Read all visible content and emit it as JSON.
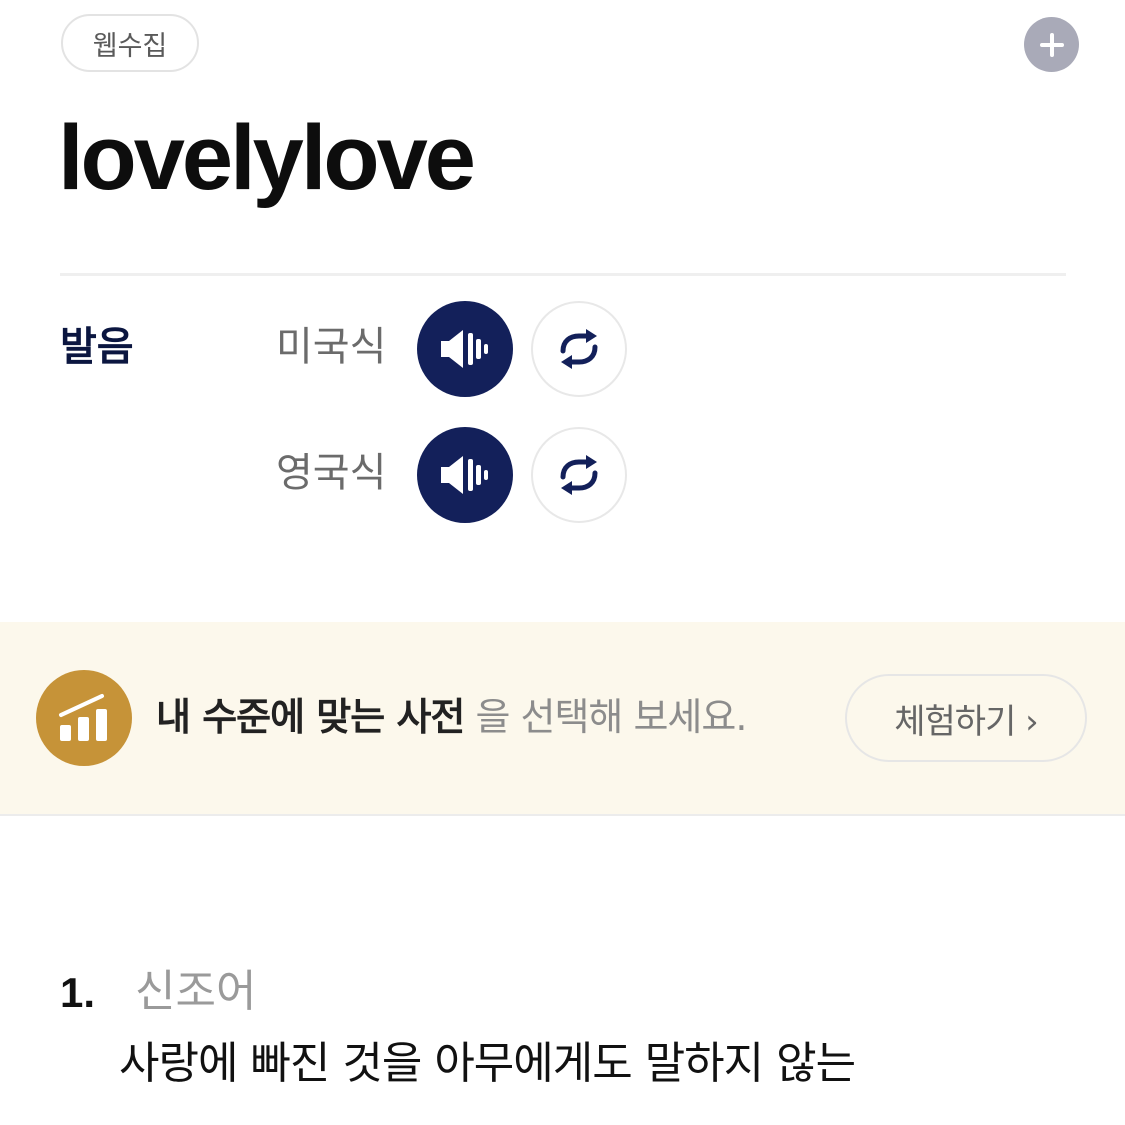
{
  "tag": {
    "label": "웹수집"
  },
  "entry": {
    "headword": "lovelylove"
  },
  "pronunciation": {
    "title": "발음",
    "accents": [
      {
        "label": "미국식"
      },
      {
        "label": "영국식"
      }
    ]
  },
  "banner": {
    "highlight": "내 수준에 맞는 사전",
    "rest": "을 선택해 보세요.",
    "button_label": "체험하기 ›"
  },
  "definitions": [
    {
      "number": "1.",
      "category": "신조어",
      "text": "사랑에 빠진 것을 아무에게도 말하지 않는"
    }
  ],
  "colors": {
    "speaker_bg": "#13205a",
    "banner_bg": "#fcf8ec",
    "level_icon_bg": "#c69338",
    "add_button_bg": "#a9aab8"
  },
  "icons": {
    "add": "plus-icon",
    "speaker": "speaker-icon",
    "repeat": "repeat-icon",
    "level": "bar-chart-icon"
  }
}
